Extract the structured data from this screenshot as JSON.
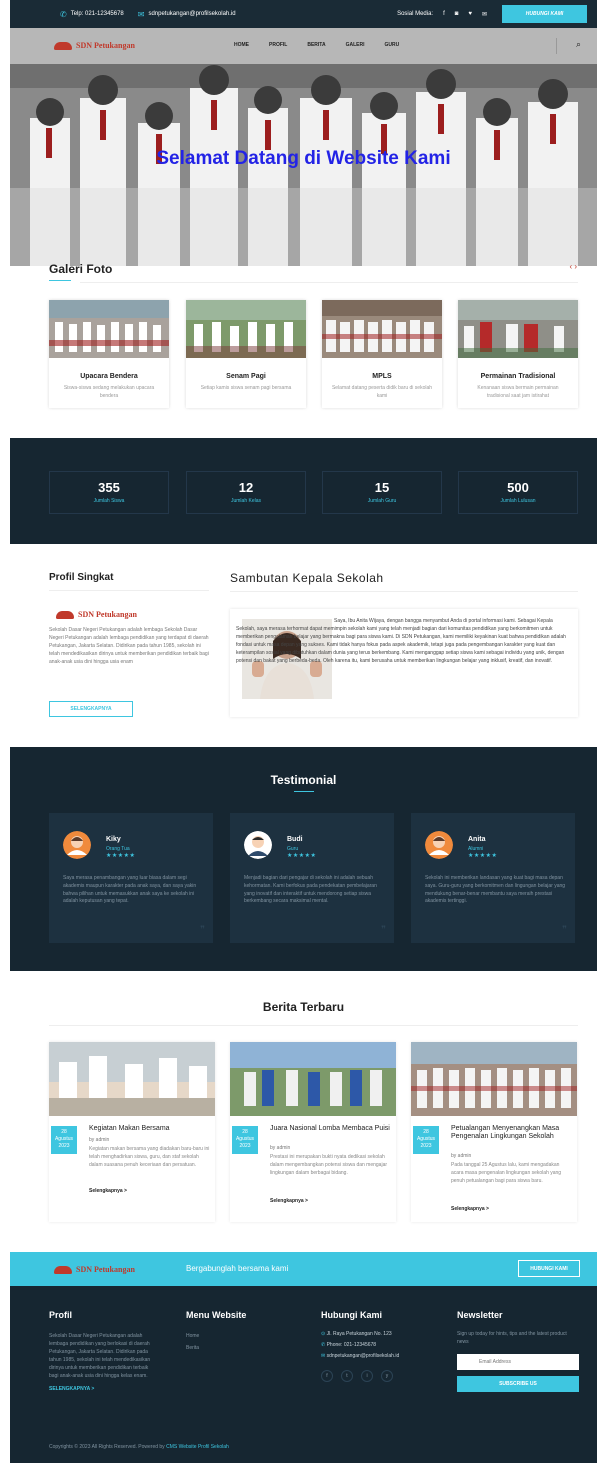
{
  "topbar": {
    "phone": "Telp: 021-12345678",
    "email": "sdnpetukangan@profilsekolah.id",
    "social_label": "Sosial Media:",
    "social_icons": [
      "f",
      "◙",
      "♥",
      "✉"
    ],
    "contact_button": "HUBUNGI KAMI"
  },
  "nav": {
    "logo_text": "SDN Petukangan",
    "menu": [
      "HOME",
      "PROFIL",
      "BERITA",
      "GALERI",
      "GURU"
    ]
  },
  "hero": {
    "headline": "Selamat Datang di Website Kami"
  },
  "gallery": {
    "title": "Galeri Foto",
    "arrows": "‹ ›",
    "items": [
      {
        "title": "Upacara Bendera",
        "desc": "Siswa-siswa sedang melakukan upacara bendera"
      },
      {
        "title": "Senam Pagi",
        "desc": "Setiap kamis siswa senam pagi bersama"
      },
      {
        "title": "MPLS",
        "desc": "Selamat datang peserta didik baru di sekolah kami"
      },
      {
        "title": "Permainan Tradisional",
        "desc": "Kenanaan siswa bermain permainan tradisional saat jam istirahat"
      }
    ]
  },
  "stats": [
    {
      "value": "355",
      "label": "Jumlah Siswa"
    },
    {
      "value": "12",
      "label": "Jumlah Kelas"
    },
    {
      "value": "15",
      "label": "Jumlah Guru"
    },
    {
      "value": "500",
      "label": "Jumlah Lulusan"
    }
  ],
  "profile": {
    "title": "Profil Singkat",
    "logo_text": "SDN Petukangan",
    "text": "Sekolah Dasar Negeri Petukangan adalah lembaga Sekolah Dasar Negeri Petukangan adalah lembaga pendidikan yang terdapat di daerah Petukangan, Jakarta Selatan. Didirikan pada tahun 1985, sekolah ini telah mendedikasikan dirinya untuk memberikan pendidikan terbaik bagi anak-anak usia dini hingga usia enam",
    "button": "SELENGKAPNYA"
  },
  "welcome": {
    "title": "Sambutan Kepala Sekolah",
    "text": "Saya, Ibu Anita Wijaya, dengan bangga menyambut Anda di portal informasi kami. Sebagai Kepala Sekolah, saya merasa terhormat dapat memimpin sekolah kami yang telah menjadi bagian dari komunitas pendidikan yang berkomitmen untuk memberikan pengalaman belajar yang bermakna bagi para siswa kami. Di SDN Petukangan, kami memiliki keyakinan kuat bahwa pendidikan adalah fondasi untuk masa depan yang sukses. Kami tidak hanya fokus pada aspek akademik, tetapi juga pada pengembangan karakter yang kuat dan keterampilan sosial yang dibutuhkan dalam dunia yang terus berkembang. Kami menganggap setiap siswa kami sebagai individu yang unik, dengan potensi dan bakat yang berbeda-beda. Oleh karena itu, kami berusaha untuk memberikan lingkungan belajar yang inklusif, kreatif, dan inovatif."
  },
  "testimonial": {
    "title": "Testimonial",
    "items": [
      {
        "name": "Kiky",
        "role": "Orang Tua",
        "stars": "★★★★★",
        "text": "Saya merasa penambangan yang luar biasa dalam segi akademis maupun karakter pada anak saya, dan saya yakin bahwa pilihan untuk memasukkan anak saya ke sekolah ini adalah keputusan yang tepat."
      },
      {
        "name": "Budi",
        "role": "Guru",
        "stars": "★★★★★",
        "text": "Menjadi bagian dari pengajar di sekolah ini adalah sebuah kehormatan. Kami berfokus pada pendekatan pembelajaran yang inovatif dan interaktif untuk mendorong setiap siswa berkembang secara maksimal mental."
      },
      {
        "name": "Anita",
        "role": "Alumni",
        "stars": "★★★★★",
        "text": "Sekolah ini memberikan landasan yang kuat bagi masa depan saya. Guru-guru yang berkomitmen dan lingungan belajar yang mendukung benar-benar membantu saya meraih prestasi akademis tertinggi."
      }
    ]
  },
  "news": {
    "title": "Berita Terbaru",
    "items": [
      {
        "day": "28",
        "month": "Agustus",
        "year": "2023",
        "title": "Kegiatan Makan Bersama",
        "author": "by admin",
        "desc": "Kegiatan makan bersama yang diadakan baru-baru ini telah menghadirkan siswa, guru, dan staf sekolah dalam suasana penuh keceriaan dan persatuan.",
        "more": "Selengkapnya >"
      },
      {
        "day": "28",
        "month": "Agustus",
        "year": "2023",
        "title": "Juara Nasional Lomba Membaca Puisi",
        "author": "by admin",
        "desc": "Prestasi ini merupakan bukti nyata dedikasi sekolah dalam mengembangkan potensi siswa dan mengajar lingkungan dalam berbagai bidang.",
        "more": "Selengkapnya >"
      },
      {
        "day": "28",
        "month": "Agustus",
        "year": "2023",
        "title": "Petualangan Menyenangkan Masa Pengenalan Lingkungan Sekolah",
        "author": "by admin",
        "desc": "Pada tanggal 25 Agustus lalu, kami mengadakan acara masa pengenalan lingkungan sekolah yang penuh petualangan bagi para siswa baru.",
        "more": "Selengkapnya >"
      }
    ]
  },
  "cta": {
    "logo_text": "SDN Petukangan",
    "text": "Bergabunglah bersama kami",
    "button": "HUBUNGI KAMI"
  },
  "footer": {
    "profil_title": "Profil",
    "profil_text": "Sekolah Dasar Negeri Petukangan adalah lembaga pendidikan yang berlokasi di daerah Petukangan, Jakarta Selatan. Didirikan pada tahun 1985, sekolah ini telah mendedikasikan dirinya untuk memberikan pendidikan terbaik bagi anak-anak usia dini hingga kelas enam.",
    "profil_more": "SELENGKAPNYA >",
    "menu_title": "Menu Website",
    "menu_items": [
      "Home",
      "Berita"
    ],
    "contact_title": "Hubungi Kami",
    "address": "Jl. Raya Petukangan No. 123",
    "phone": "Phone: 021-12345678",
    "email": "sdnpetukangan@profilsekolah.id",
    "newsletter_title": "Newsletter",
    "newsletter_text": "Sign up today for hints, tips and the latest product news",
    "email_placeholder": "Email Address",
    "subscribe": "SUBSCRIBE US",
    "copyright_prefix": "Copyrights © 2023 All Rights Reserved. Powered by ",
    "copyright_link": "CMS Website Profil Sekolah"
  },
  "colors": {
    "accent": "#3ec6e0",
    "dark": "#162631",
    "headline": "#2323e6",
    "brand": "#c0392b"
  }
}
